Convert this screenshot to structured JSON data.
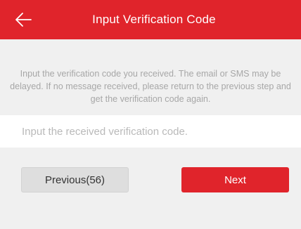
{
  "header": {
    "title": "Input Verification Code",
    "back_icon": "arrow-left-icon"
  },
  "instructions": {
    "text": "Input the verification code you received. The email or SMS may be delayed. If no message received, please return to the previous step and get the verification code again."
  },
  "code_field": {
    "value": "",
    "placeholder": "Input the received verification code."
  },
  "actions": {
    "previous_label": "Previous(56)",
    "next_label": "Next"
  },
  "colors": {
    "accent": "#e0242b",
    "background": "#f0f0f0",
    "secondary_button": "#dedede"
  }
}
